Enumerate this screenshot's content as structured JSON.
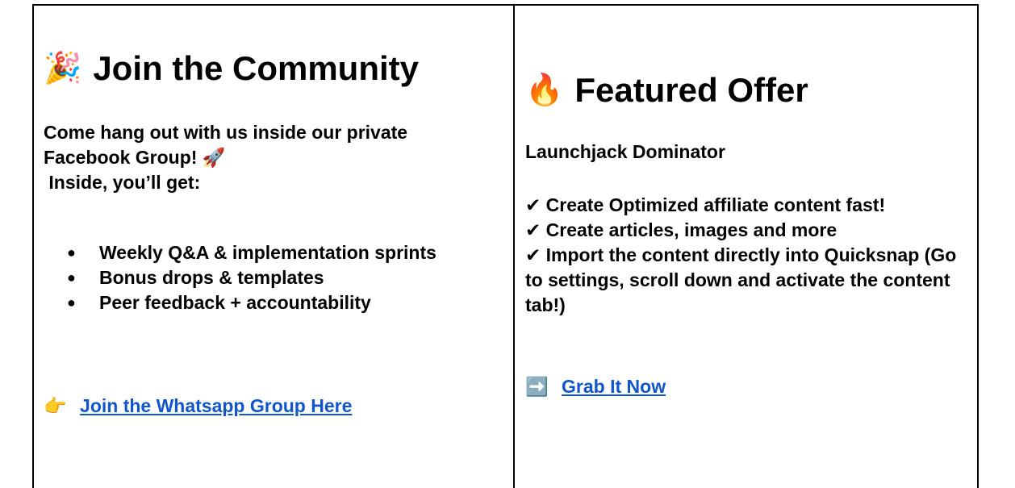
{
  "left": {
    "heading_emoji": "🎉",
    "heading": "Join the Community",
    "intro_line1": "Come hang out with us inside our private",
    "intro_line2": "Facebook Group! 🚀",
    "intro_line3": " Inside, you’ll get:",
    "bullets": [
      "Weekly Q&A & implementation sprints",
      "Bonus drops & templates",
      "Peer feedback + accountability"
    ],
    "bullet_marker": "●",
    "link_emoji": "👉",
    "link_text": "Join the Whatsapp Group Here"
  },
  "right": {
    "heading_emoji": "🔥",
    "heading": "Featured Offer",
    "offer_name": "Launchjack Dominator",
    "checks": [
      "✔ Create Optimized affiliate content fast!",
      "✔ Create articles, images and more",
      "✔ Import the content directly into Quicksnap (Go to settings, scroll down and activate the content tab!)"
    ],
    "link_emoji": "➡️",
    "link_text": "Grab It Now"
  },
  "colors": {
    "link": "#1155cc",
    "border": "#000000",
    "text": "#000000"
  }
}
